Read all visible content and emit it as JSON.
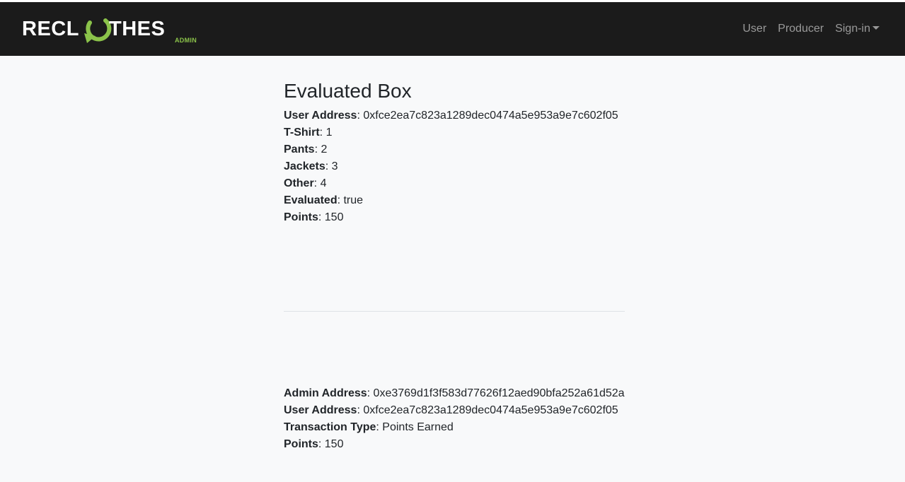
{
  "navbar": {
    "brand": {
      "text_left": "RECL",
      "text_right": "THES",
      "subtitle": "ADMIN",
      "logo_icon": "recycle-arrow-icon",
      "accent_color": "#8bc34a"
    },
    "links": [
      {
        "label": "User"
      },
      {
        "label": "Producer"
      },
      {
        "label": "Sign-in",
        "dropdown": true
      }
    ]
  },
  "box": {
    "title": "Evaluated Box",
    "fields": [
      {
        "label": "User Address",
        "value": ": 0xfce2ea7c823a1289dec0474a5e953a9e7c602f05"
      },
      {
        "label": "T-Shirt",
        "value": ": 1"
      },
      {
        "label": "Pants",
        "value": ": 2"
      },
      {
        "label": "Jackets",
        "value": ": 3"
      },
      {
        "label": "Other",
        "value": ": 4"
      },
      {
        "label": "Evaluated",
        "value": ": true"
      },
      {
        "label": "Points",
        "value": ": 150"
      }
    ]
  },
  "transaction": {
    "fields": [
      {
        "label": "Admin Address",
        "value": ": 0xe3769d1f3f583d77626f12aed90bfa252a61d52a"
      },
      {
        "label": "User Address",
        "value": ": 0xfce2ea7c823a1289dec0474a5e953a9e7c602f05"
      },
      {
        "label": "Transaction Type",
        "value": ": Points Earned"
      },
      {
        "label": "Points",
        "value": ": 150"
      }
    ]
  }
}
